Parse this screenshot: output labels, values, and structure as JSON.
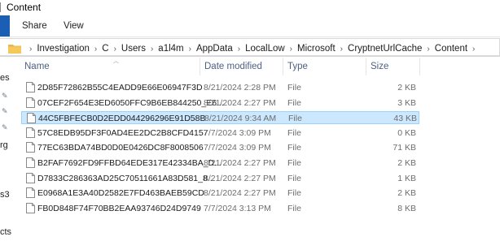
{
  "window": {
    "title": "Content"
  },
  "ribbon": {
    "tabs": [
      "Share",
      "View"
    ]
  },
  "address": {
    "crumbs": [
      "Investigation",
      "C",
      "Users",
      "a1l4m",
      "AppData",
      "LocalLow",
      "Microsoft",
      "CryptnetUrlCache",
      "Content"
    ]
  },
  "nav_fragments": [
    "es",
    "rg",
    "s3",
    "cts"
  ],
  "columns": {
    "name": "Name",
    "date": "Date modified",
    "type": "Type",
    "size": "Size"
  },
  "files": [
    {
      "name": "2D85F72862B55C4EADD9E66E06947F3D",
      "date": "8/21/2024 2:28 PM",
      "type": "File",
      "size": "2 KB"
    },
    {
      "name": "07CEF2F654E3ED6050FFC9B6EB844250_E6...",
      "date": "8/21/2024 2:27 PM",
      "type": "File",
      "size": "3 KB"
    },
    {
      "name": "44C5FBFECB0D2EDD044296296E91D58B",
      "date": "8/21/2024 9:34 AM",
      "type": "File",
      "size": "43 KB",
      "selected": true
    },
    {
      "name": "57C8EDB95DF3F0AD4EE2DC2B8CFD4157",
      "date": "7/7/2024 3:09 PM",
      "type": "File",
      "size": "0 KB"
    },
    {
      "name": "77EC63BDA74BD0D0E0426DC8F8008506",
      "date": "7/7/2024 3:09 PM",
      "type": "File",
      "size": "71 KB"
    },
    {
      "name": "B2FAF7692FD9FFBD64EDE317E42334BA_D...",
      "date": "8/21/2024 2:27 PM",
      "type": "File",
      "size": "2 KB"
    },
    {
      "name": "D7833C286363AD25C70511661A83D581_8...",
      "date": "8/21/2024 2:27 PM",
      "type": "File",
      "size": "1 KB"
    },
    {
      "name": "E0968A1E3A40D2582E7FD463BAEB59CD",
      "date": "8/21/2024 2:27 PM",
      "type": "File",
      "size": "2 KB"
    },
    {
      "name": "FB0D848F74F70BB2EAA93746D24D9749",
      "date": "7/7/2024 3:13 PM",
      "type": "File",
      "size": "8 KB"
    }
  ],
  "colors": {
    "selection_bg": "#cce8ff",
    "selection_border": "#99d1ff",
    "header_text": "#4d6082",
    "file_tab": "#1a5fb4"
  },
  "icons": {
    "folder": "folder-icon",
    "file": "file-icon",
    "pin": "pin-icon",
    "breadcrumb_separator": "chevron-right-icon"
  }
}
